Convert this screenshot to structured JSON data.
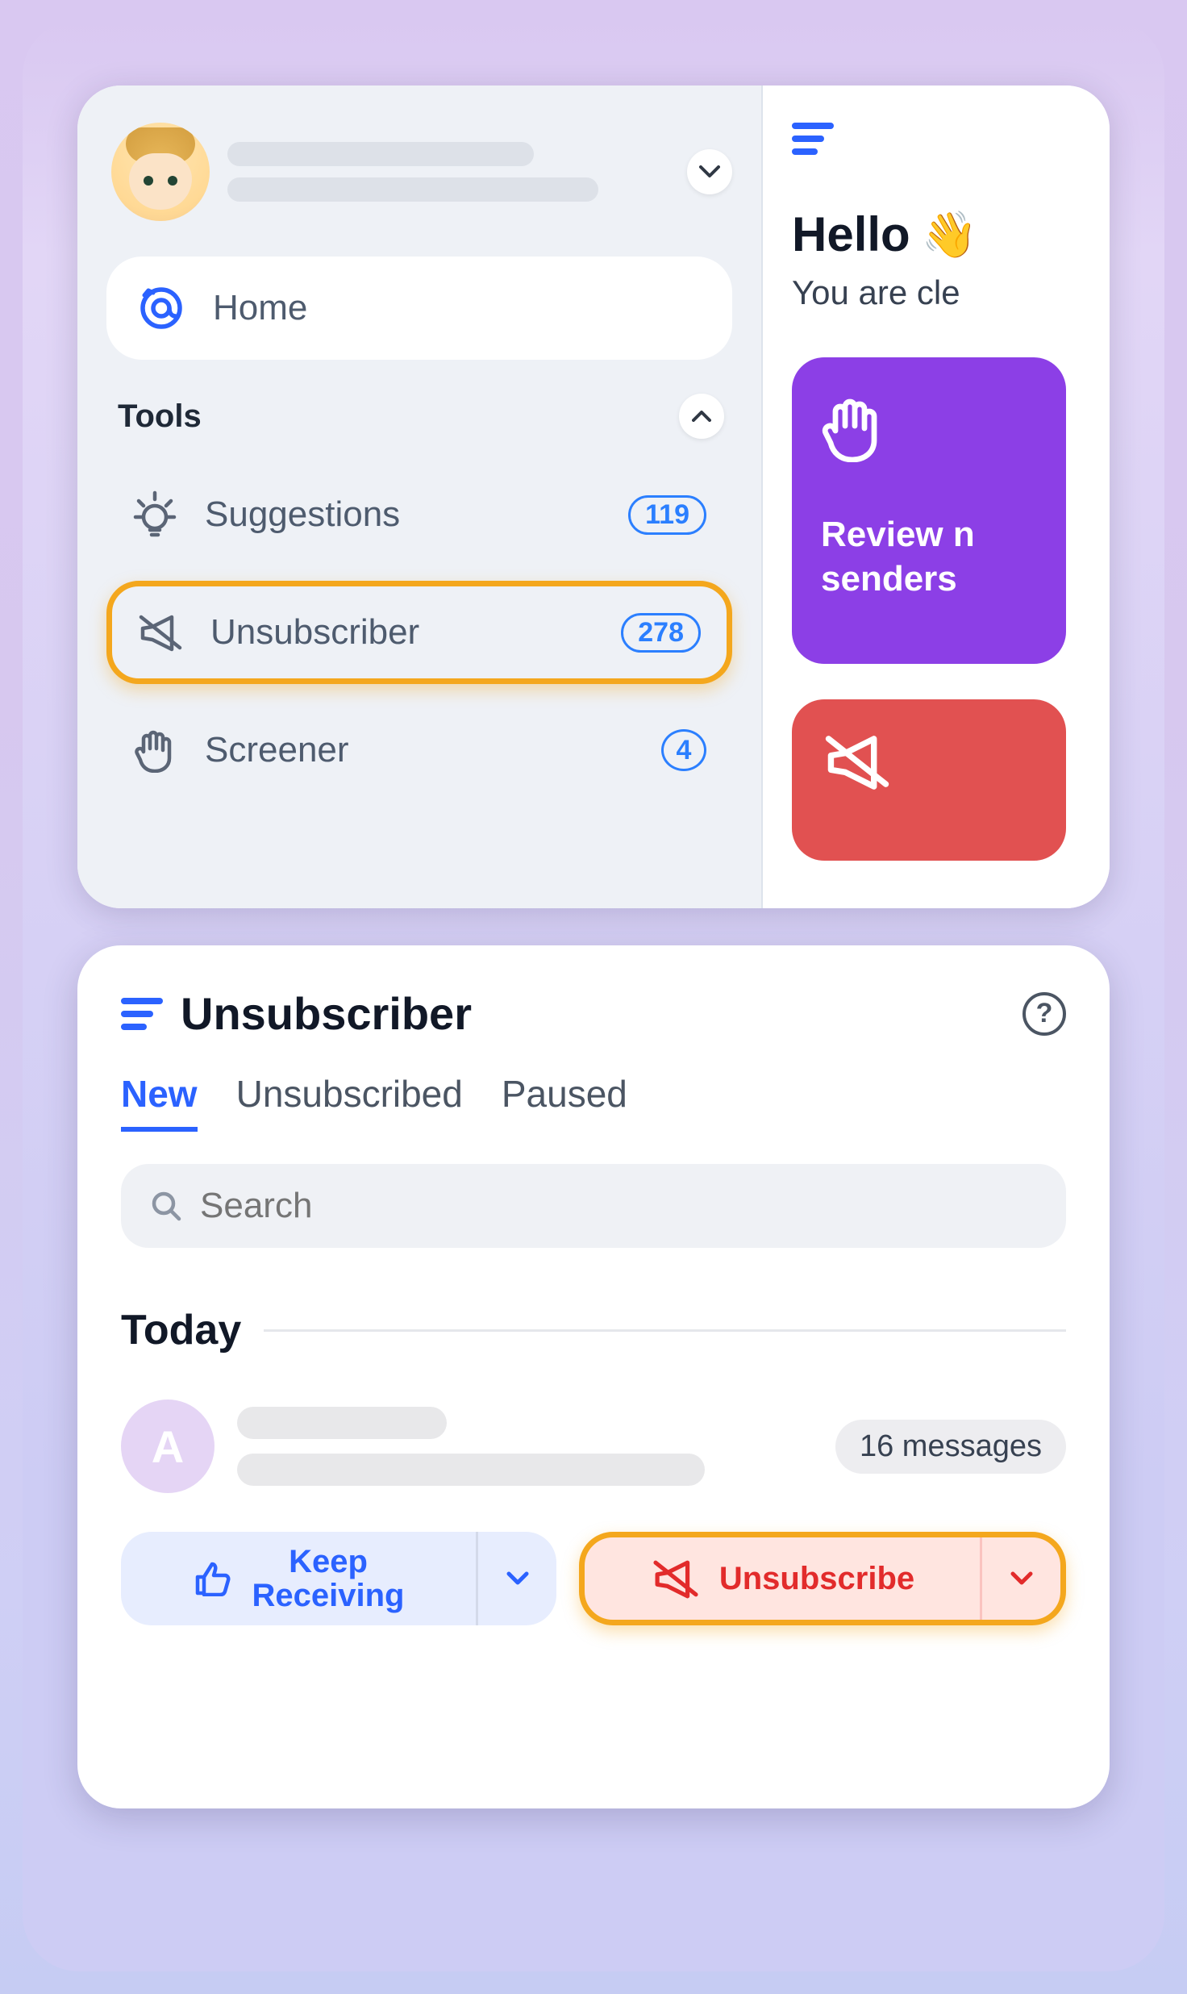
{
  "sidebar": {
    "home_label": "Home",
    "tools_label": "Tools",
    "items": [
      {
        "label": "Suggestions",
        "badge": "119"
      },
      {
        "label": "Unsubscriber",
        "badge": "278"
      },
      {
        "label": "Screener",
        "badge": "4"
      }
    ]
  },
  "homepanel": {
    "hello": "Hello",
    "wave_emoji": "👋",
    "subtext": "You are cle",
    "purple_card": {
      "line1": "Review n",
      "line2": "senders"
    }
  },
  "unsubscriber": {
    "title": "Unsubscriber",
    "tabs": {
      "new": "New",
      "unsubscribed": "Unsubscribed",
      "paused": "Paused"
    },
    "search_placeholder": "Search",
    "section": "Today",
    "sender": {
      "initial": "A",
      "count_label": "16 messages"
    },
    "keep_label_1": "Keep",
    "keep_label_2": "Receiving",
    "unsubscribe_label": "Unsubscribe",
    "help_glyph": "?"
  },
  "colors": {
    "accent_blue": "#2B62FF",
    "highlight_orange": "#F4A71D",
    "purple": "#8C3FE6",
    "danger": "#E22B2B"
  }
}
